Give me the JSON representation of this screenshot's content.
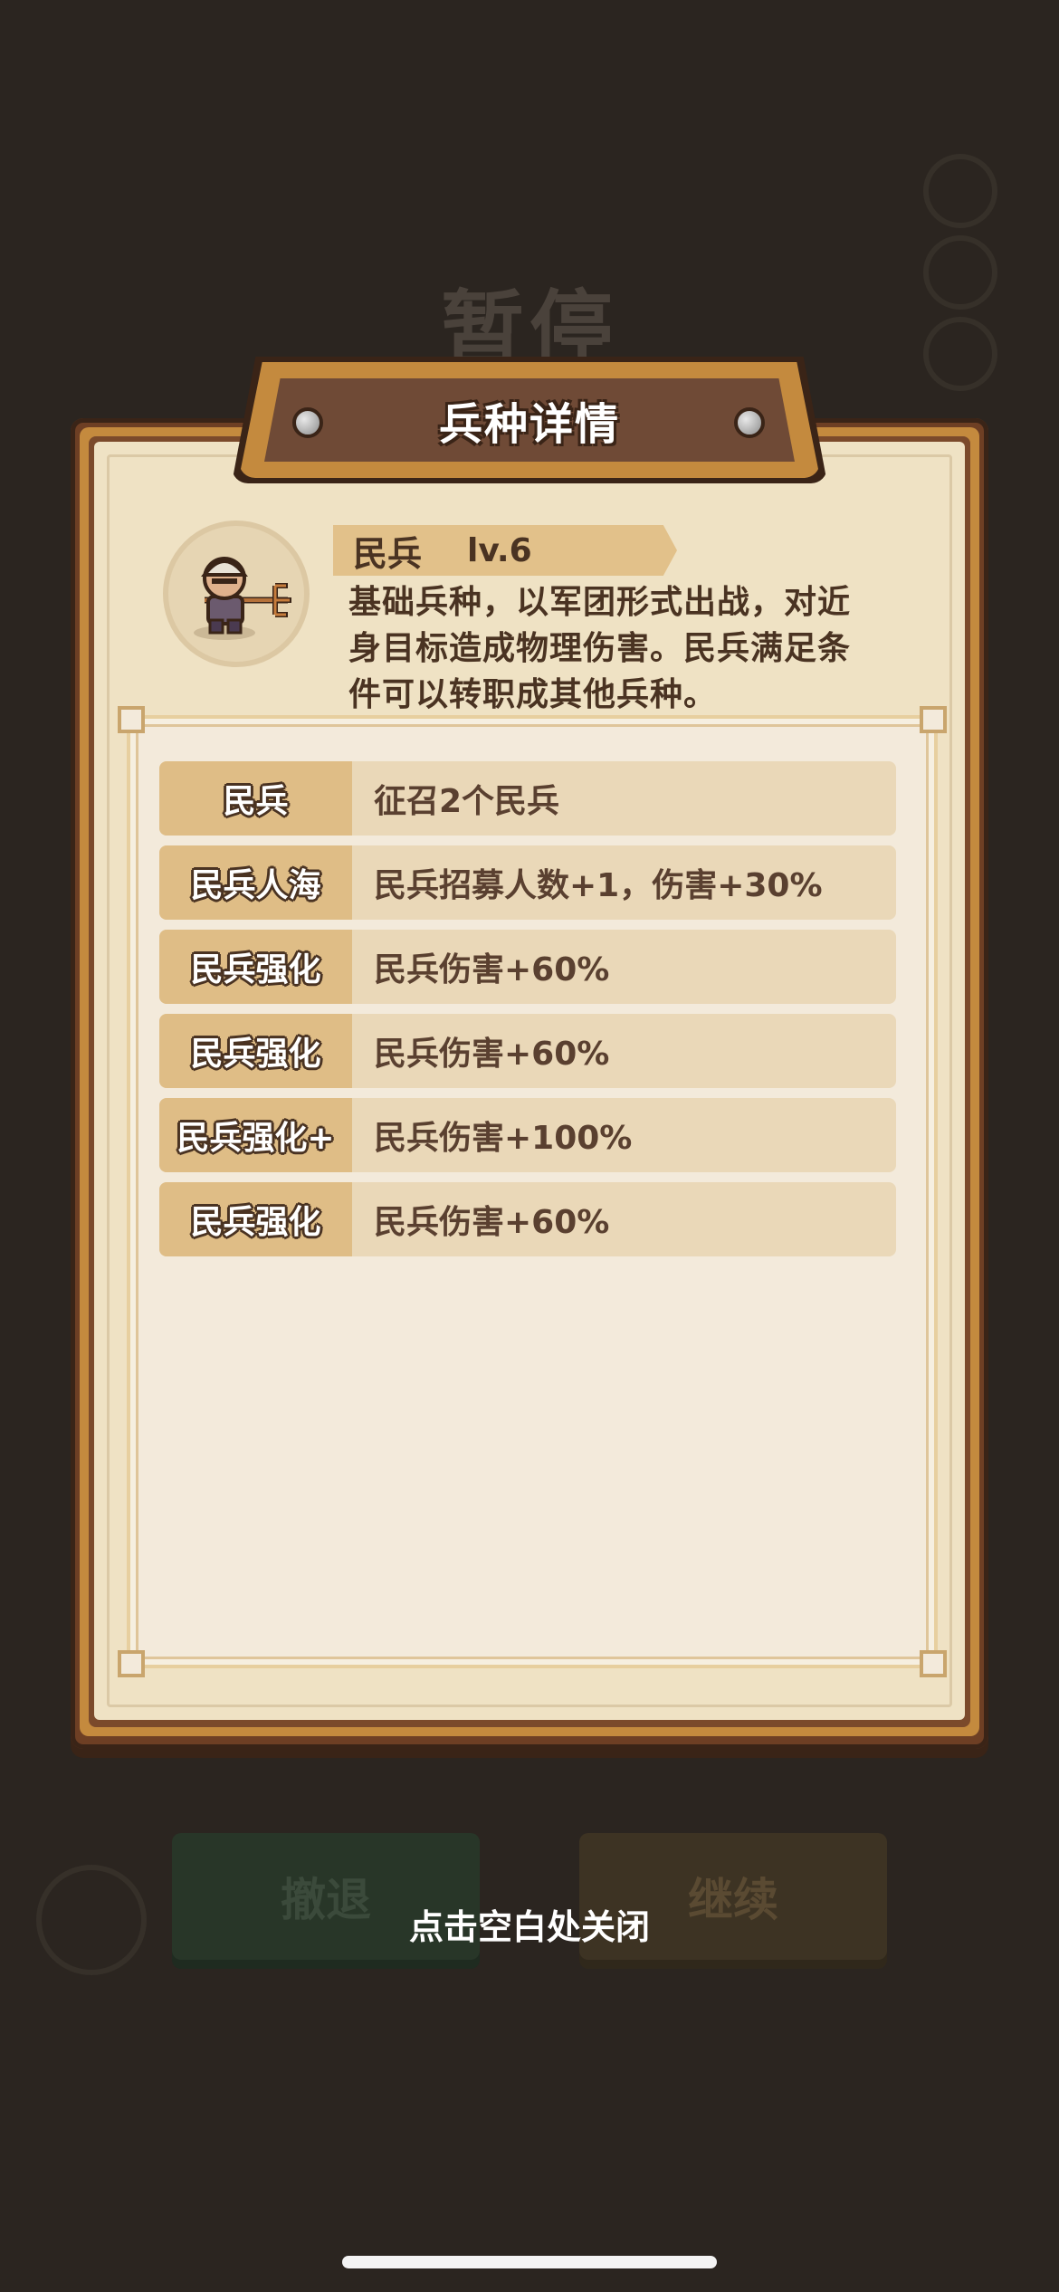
{
  "background": {
    "pause_title": "暂停",
    "retreat_label": "撤退",
    "continue_label": "继续"
  },
  "dialog": {
    "title": "兵种详情",
    "unit": {
      "name": "民兵",
      "level": "lv.6",
      "description": "基础兵种，以军团形式出战，对近身目标造成物理伤害。民兵满足条件可以转职成其他兵种。",
      "portrait_icon": "militia-pitchfork-icon"
    },
    "upgrades": [
      {
        "label": "民兵",
        "value": "征召2个民兵"
      },
      {
        "label": "民兵人海",
        "value": "民兵招募人数+1，伤害+30%"
      },
      {
        "label": "民兵强化",
        "value": "民兵伤害+60%"
      },
      {
        "label": "民兵强化",
        "value": "民兵伤害+60%"
      },
      {
        "label": "民兵强化+",
        "value": "民兵伤害+100%"
      },
      {
        "label": "民兵强化",
        "value": "民兵伤害+60%"
      }
    ]
  },
  "close_hint": "点击空白处关闭",
  "colors": {
    "overlay": "#2b2520",
    "panel_wood": "#6e3f24",
    "gold_trim": "#c48a3e",
    "parchment": "#efe2c4",
    "label_bg": "#dfbd86",
    "row_bg": "#ead8b8",
    "text_dark": "#4a3322"
  }
}
